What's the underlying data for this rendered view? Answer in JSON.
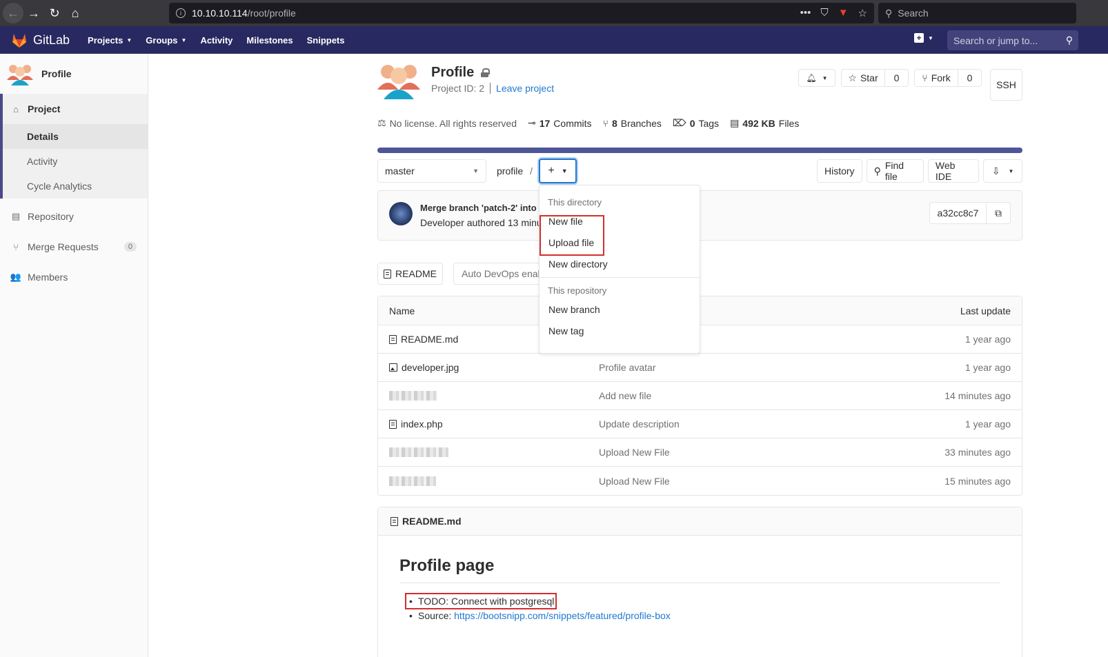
{
  "browser": {
    "url_host": "10.10.10.114",
    "url_path": "/root/profile",
    "search_placeholder": "Search"
  },
  "header": {
    "brand": "GitLab",
    "nav": [
      "Projects",
      "Groups",
      "Activity",
      "Milestones",
      "Snippets"
    ],
    "search_placeholder": "Search or jump to..."
  },
  "sidebar": {
    "project_name": "Profile",
    "project_label": "Project",
    "sub_items": [
      "Details",
      "Activity",
      "Cycle Analytics"
    ],
    "repository": "Repository",
    "merge_requests": "Merge Requests",
    "merge_requests_count": "0",
    "members": "Members"
  },
  "project": {
    "title": "Profile",
    "id_text": "Project ID: 2",
    "leave": "Leave project",
    "star_label": "Star",
    "star_count": "0",
    "fork_label": "Fork",
    "fork_count": "0",
    "ssh_label": "SSH"
  },
  "stats": {
    "license": "No license. All rights reserved",
    "commits_count": "17",
    "commits_label": "Commits",
    "branches_count": "8",
    "branches_label": "Branches",
    "tags_count": "0",
    "tags_label": "Tags",
    "files_size": "492 KB",
    "files_label": "Files"
  },
  "tree": {
    "branch": "master",
    "path": "profile",
    "slash": "/",
    "history": "History",
    "find_file": "Find file",
    "web_ide": "Web IDE"
  },
  "commit": {
    "title": "Merge branch 'patch-2' into",
    "meta": "Developer authored 13 minut",
    "sha": "a32cc8c7"
  },
  "buttons": {
    "readme": "README",
    "autodevops": "Auto DevOps enab"
  },
  "file_table": {
    "col_name": "Name",
    "col_last_update": "Last update",
    "rows": [
      {
        "name": "README.md",
        "message": "",
        "date": "1 year ago"
      },
      {
        "name": "developer.jpg",
        "message": "Profile avatar",
        "date": "1 year ago"
      },
      {
        "name": "",
        "message": "Add new file",
        "date": "14 minutes ago"
      },
      {
        "name": "index.php",
        "message": "Update description",
        "date": "1 year ago"
      },
      {
        "name": "",
        "message": "Upload New File",
        "date": "33 minutes ago"
      },
      {
        "name": "",
        "message": "Upload New File",
        "date": "15 minutes ago"
      }
    ]
  },
  "readme": {
    "filename": "README.md",
    "heading": "Profile page",
    "todo": "TODO: Connect with postgresql",
    "source_label": "Source: ",
    "source_link": "https://bootsnipp.com/snippets/featured/profile-box"
  },
  "dropdown": {
    "header_dir": "This directory",
    "new_file": "New file",
    "upload_file": "Upload file",
    "new_directory": "New directory",
    "header_repo": "This repository",
    "new_branch": "New branch",
    "new_tag": "New tag"
  },
  "colors": {
    "header_bg": "#292961",
    "link": "#1f78d1",
    "highlight_box": "#d22d2d"
  }
}
